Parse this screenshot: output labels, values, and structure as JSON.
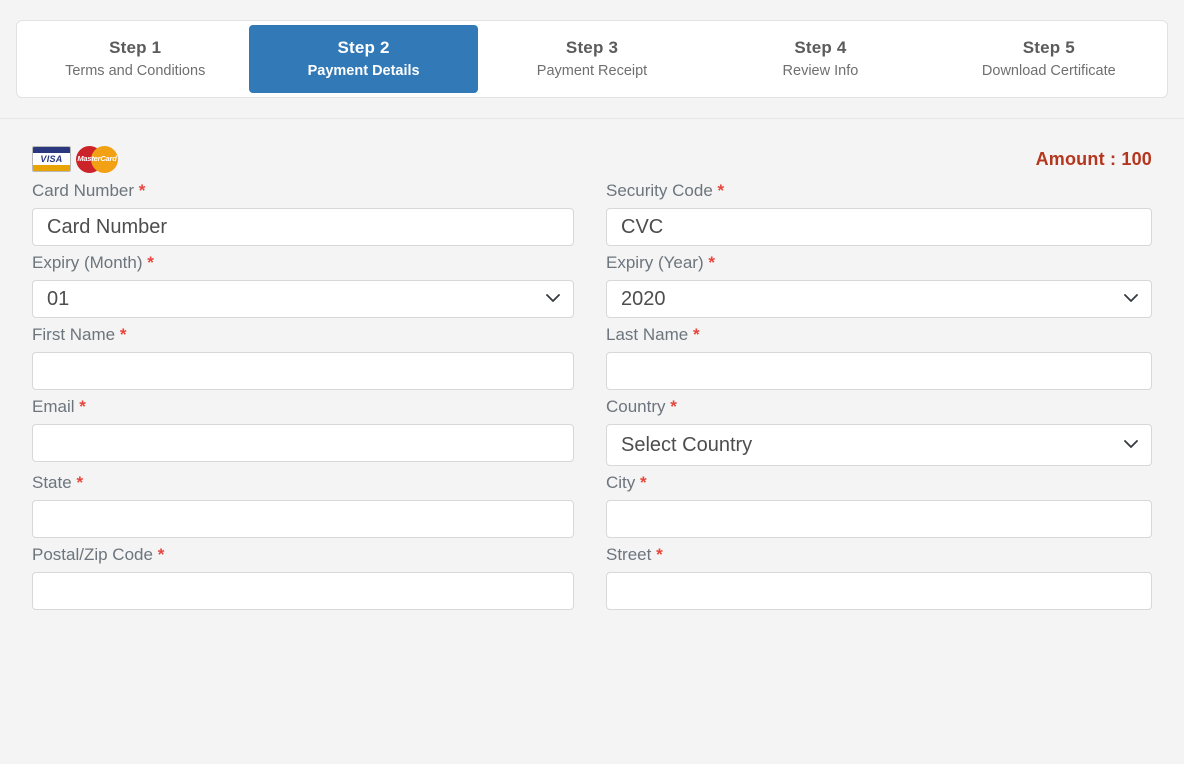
{
  "stepper": {
    "steps": [
      {
        "num": "Step 1",
        "label": "Terms and Conditions",
        "active": false
      },
      {
        "num": "Step 2",
        "label": "Payment Details",
        "active": true
      },
      {
        "num": "Step 3",
        "label": "Payment Receipt",
        "active": false
      },
      {
        "num": "Step 4",
        "label": "Review Info",
        "active": false
      },
      {
        "num": "Step 5",
        "label": "Download Certificate",
        "active": false
      }
    ],
    "active_color": "#3279b7"
  },
  "payment": {
    "logos": {
      "visa": "VISA",
      "mastercard": "MasterCard"
    },
    "amount_text": "Amount : 100",
    "amount_color": "#b5361f",
    "required_marker": "*",
    "fields": {
      "card_number": {
        "label": "Card Number",
        "placeholder": "Card Number",
        "value": ""
      },
      "security_code": {
        "label": "Security Code",
        "placeholder": "CVC",
        "value": ""
      },
      "expiry_month": {
        "label": "Expiry (Month)",
        "value": "01"
      },
      "expiry_year": {
        "label": "Expiry (Year)",
        "value": "2020"
      },
      "first_name": {
        "label": "First Name",
        "placeholder": "",
        "value": ""
      },
      "last_name": {
        "label": "Last Name",
        "placeholder": "",
        "value": ""
      },
      "email": {
        "label": "Email",
        "placeholder": "",
        "value": ""
      },
      "country": {
        "label": "Country",
        "value": "Select Country"
      },
      "state": {
        "label": "State",
        "placeholder": "",
        "value": ""
      },
      "city": {
        "label": "City",
        "placeholder": "",
        "value": ""
      },
      "postal_code": {
        "label": "Postal/Zip Code",
        "placeholder": "",
        "value": ""
      },
      "street": {
        "label": "Street",
        "placeholder": "",
        "value": ""
      }
    }
  }
}
